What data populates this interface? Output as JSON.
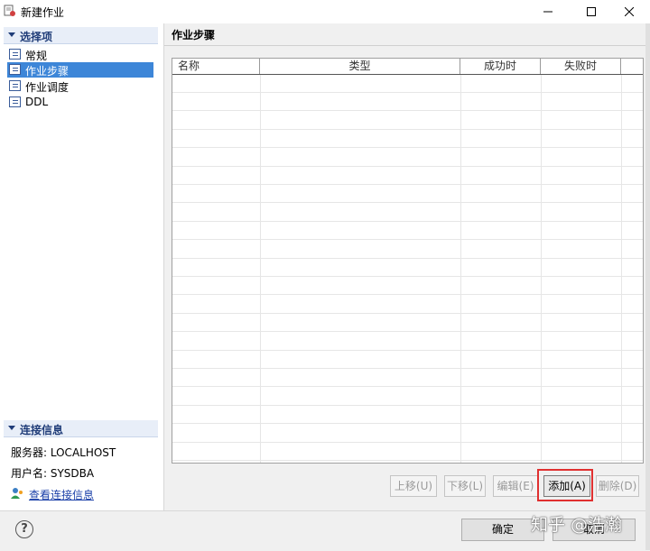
{
  "window": {
    "title": "新建作业"
  },
  "sidebar": {
    "options_header": "选择项",
    "items": [
      {
        "label": "常规",
        "selected": false
      },
      {
        "label": "作业步骤",
        "selected": true
      },
      {
        "label": "作业调度",
        "selected": false
      },
      {
        "label": "DDL",
        "selected": false
      }
    ],
    "connection_header": "连接信息",
    "server_line": "服务器: LOCALHOST",
    "user_line": "用户名: SYSDBA",
    "view_connection_link": "查看连接信息"
  },
  "main": {
    "page_title": "作业步骤",
    "table": {
      "columns": [
        "名称",
        "类型",
        "成功时",
        "失败时"
      ],
      "rows": []
    },
    "buttons": {
      "up": "上移(U)",
      "down": "下移(L)",
      "edit": "编辑(E)",
      "add": "添加(A)",
      "delete": "删除(D)"
    }
  },
  "footer": {
    "ok": "确定",
    "cancel": "取消",
    "watermark": "知乎 @浩瀚"
  },
  "colors": {
    "selection": "#3d86d8",
    "highlight_box": "#e03030",
    "link": "#1a3fa8"
  }
}
